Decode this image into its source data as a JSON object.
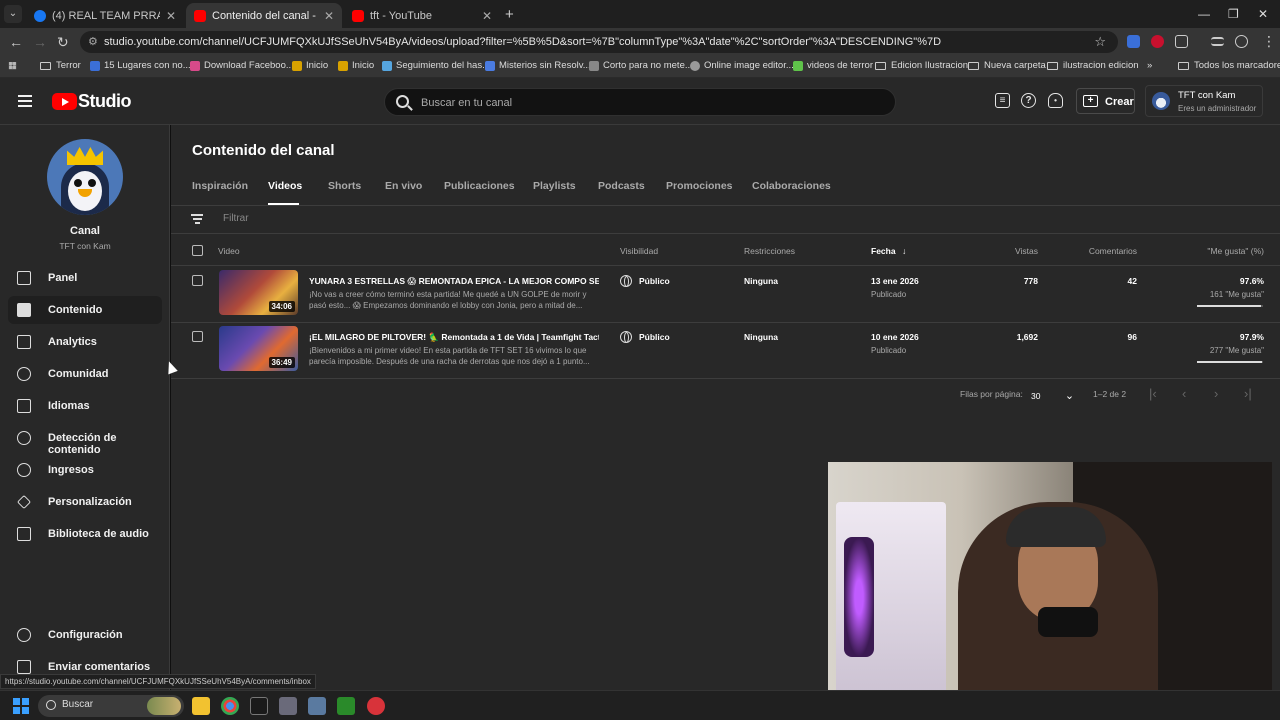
{
  "browser": {
    "tabs": [
      {
        "label": "(4) REAL TEAM PRRAS! | Facebo",
        "favicon_color": "#1877f2",
        "active": false
      },
      {
        "label": "Contenido del canal - YouTube",
        "favicon_color": "#ff0000",
        "active": true
      },
      {
        "label": "tft - YouTube",
        "favicon_color": "#ff0000",
        "active": false
      }
    ],
    "new_tab": "+",
    "window_controls": {
      "minimize": "—",
      "restore": "❐",
      "close": "✕"
    },
    "url": "studio.youtube.com/channel/UCFJUMFQXkUJfSSeUhV54ByA/videos/upload?filter=%5B%5D&sort=%7B\"columnType\"%3A\"date\"%2C\"sortOrder\"%3A\"DESCENDING\"%7D",
    "bookmarks": [
      {
        "label": "Terror",
        "type": "folder"
      },
      {
        "label": "15 Lugares con no...",
        "color": "#3b6fd8"
      },
      {
        "label": "Download Faceboo...",
        "color": "#d84a8a"
      },
      {
        "label": "Inicio",
        "color": "#d8a200"
      },
      {
        "label": "Inicio",
        "color": "#d8a200"
      },
      {
        "label": "Seguimiento del has...",
        "color": "#56a6e0"
      },
      {
        "label": "Misterios sin Resolv...",
        "color": "#4a7be0"
      },
      {
        "label": "Corto para no mete...",
        "color": "#888888"
      },
      {
        "label": "Online image editor...",
        "color": "#999999"
      },
      {
        "label": "videos de terror",
        "color": "#5fc34a"
      },
      {
        "label": "Edicion Ilustracion",
        "type": "folder"
      },
      {
        "label": "Nueva carpeta",
        "type": "folder"
      },
      {
        "label": "ilustracion edicion",
        "type": "folder"
      },
      {
        "label": "Todos los marcadores",
        "type": "folder"
      }
    ],
    "bookmarks_overflow": "»"
  },
  "studio": {
    "logo_text": "Studio",
    "search_placeholder": "Buscar en tu canal",
    "create_label": "Crear",
    "account_name": "TFT con Kam",
    "account_role": "Eres un administrador"
  },
  "sidebar": {
    "channel_title": "Canal",
    "channel_name": "TFT con Kam",
    "items": [
      {
        "label": "Panel",
        "icon": "dashboard-icon"
      },
      {
        "label": "Contenido",
        "icon": "content-icon",
        "active": true
      },
      {
        "label": "Analytics",
        "icon": "analytics-icon"
      },
      {
        "label": "Comunidad",
        "icon": "community-icon"
      },
      {
        "label": "Idiomas",
        "icon": "subtitles-icon"
      },
      {
        "label": "Detección de contenido",
        "icon": "copyright-icon"
      },
      {
        "label": "Ingresos",
        "icon": "monetization-icon"
      },
      {
        "label": "Personalización",
        "icon": "customization-icon"
      },
      {
        "label": "Biblioteca de audio",
        "icon": "audio-library-icon"
      }
    ],
    "bottom": [
      {
        "label": "Configuración",
        "icon": "settings-icon"
      },
      {
        "label": "Enviar comentarios",
        "icon": "feedback-icon"
      }
    ]
  },
  "main": {
    "title": "Contenido del canal",
    "tabs": [
      "Inspiración",
      "Videos",
      "Shorts",
      "En vivo",
      "Publicaciones",
      "Playlists",
      "Podcasts",
      "Promociones",
      "Colaboraciones"
    ],
    "active_tab": "Videos",
    "filter_placeholder": "Filtrar",
    "columns": {
      "video": "Video",
      "visibility": "Visibilidad",
      "restrictions": "Restricciones",
      "date": "Fecha",
      "views": "Vistas",
      "comments": "Comentarios",
      "likes": "\"Me gusta\" (%)"
    },
    "videos": [
      {
        "title": "YUNARA 3 ESTRELLAS 😱 REMONTADA EPICA - LA MEJOR COMPO SE...",
        "description": "¡No vas a creer cómo terminó esta partida! Me quedé a UN GOLPE de morir y pasó esto... 😱 Empezamos dominando el lobby con Jonia, pero a mitad de...",
        "duration": "34:06",
        "visibility": "Público",
        "restrictions": "Ninguna",
        "date": "13 ene 2026",
        "status": "Publicado",
        "views": "778",
        "comments": "42",
        "like_pct": "97.6%",
        "like_fraction": 0.976,
        "like_count": "161 \"Me gusta\""
      },
      {
        "title": "¡EL MILAGRO DE PILTOVER! 🦜 Remontada a 1 de Vida | Teamfight Tacti...",
        "description": "¡Bienvenidos a mi primer video! En esta partida de TFT SET 16 vivimos lo que parecía imposible. Después de una racha de derrotas que nos dejó a 1 punto...",
        "duration": "36:49",
        "visibility": "Público",
        "restrictions": "Ninguna",
        "date": "10 ene 2026",
        "status": "Publicado",
        "views": "1,692",
        "comments": "96",
        "like_pct": "97.9%",
        "like_fraction": 0.979,
        "like_count": "277 \"Me gusta\""
      }
    ],
    "pagination": {
      "rows_label": "Filas por página:",
      "rows_value": "30",
      "range": "1–2 de 2"
    }
  },
  "status_url": "https://studio.youtube.com/channel/UCFJUMFQXkUJfSSeUhV54ByA/comments/inbox",
  "taskbar": {
    "search_placeholder": "Buscar"
  }
}
